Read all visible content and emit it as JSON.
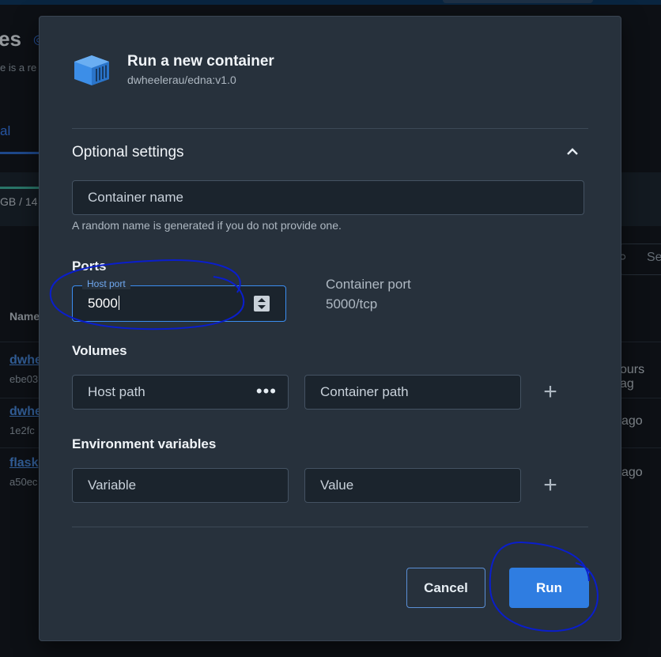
{
  "background": {
    "title_fragment": "es",
    "subtitle_fragment": "e is a re",
    "tab_fragment": "al",
    "usage_fragment": "GB / 14",
    "search_fragment": "Se",
    "column_name": "Name",
    "rows": [
      {
        "name": "dwhe",
        "id": "ebe03",
        "time": "ours ag"
      },
      {
        "name": "dwhe",
        "id": "1e2fc",
        "time": "ago"
      },
      {
        "name": "flask",
        "id": "a50ec",
        "time": "ago"
      }
    ]
  },
  "modal": {
    "title": "Run a new container",
    "image": "dwheelerau/edna:v1.0",
    "icon": "container-icon",
    "optional_settings": {
      "title": "Optional settings",
      "collapse_icon": "chevron-up-icon",
      "container_name_placeholder": "Container name",
      "container_name_hint": "A random name is generated if you do not provide one."
    },
    "ports": {
      "title": "Ports",
      "host_port_label": "Host port",
      "host_port_value": "5000",
      "container_port_label": "Container port",
      "container_port_value": "5000/tcp"
    },
    "volumes": {
      "title": "Volumes",
      "host_path_placeholder": "Host path",
      "host_path_browse_icon": "more-dots-icon",
      "container_path_placeholder": "Container path",
      "add_icon": "plus-icon"
    },
    "env": {
      "title": "Environment variables",
      "variable_placeholder": "Variable",
      "value_placeholder": "Value",
      "add_icon": "plus-icon"
    },
    "actions": {
      "cancel_label": "Cancel",
      "run_label": "Run"
    }
  },
  "colors": {
    "accent": "#2f7de1",
    "modal_bg": "#27313c",
    "annotation": "#0a1ecc"
  }
}
